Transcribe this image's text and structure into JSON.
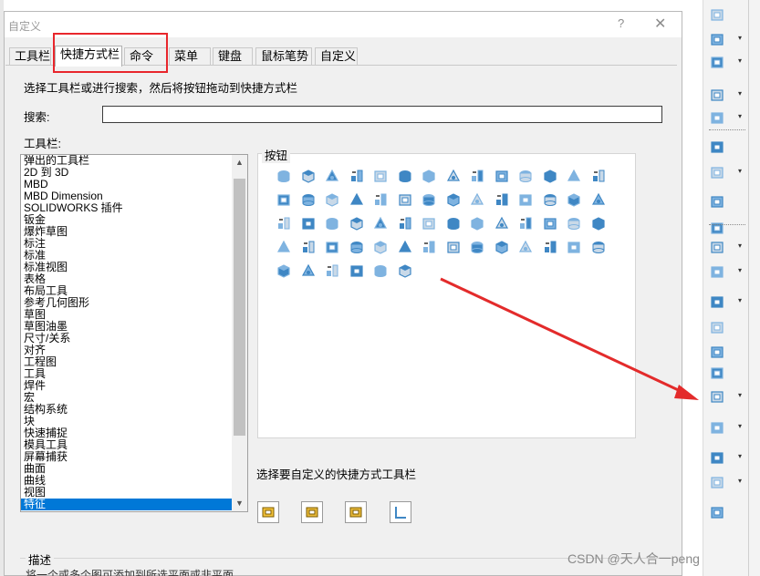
{
  "dialog": {
    "title": "自定义",
    "help_glyph": "?",
    "close_glyph": "✕"
  },
  "tabs": [
    {
      "label": "工具栏",
      "active": false
    },
    {
      "label": "快捷方式栏",
      "active": true
    },
    {
      "label": "命令",
      "active": false
    },
    {
      "label": "菜单",
      "active": false
    },
    {
      "label": "键盘",
      "active": false
    },
    {
      "label": "鼠标笔势",
      "active": false
    },
    {
      "label": "自定义",
      "active": false
    }
  ],
  "instruction": "选择工具栏或进行搜索，然后将按钮拖动到快捷方式栏",
  "search": {
    "label": "搜索:",
    "value": "",
    "placeholder": ""
  },
  "toolbars": {
    "label": "工具栏:",
    "items": [
      "弹出的工具栏",
      "2D 到 3D",
      "MBD",
      "MBD Dimension",
      "SOLIDWORKS 插件",
      "钣金",
      "爆炸草图",
      "标注",
      "标准",
      "标准视图",
      "表格",
      "布局工具",
      "参考几何图形",
      "草图",
      "草图油墨",
      "尺寸/关系",
      "对齐",
      "工程图",
      "工具",
      "焊件",
      "宏",
      "结构系统",
      "块",
      "快速捕捉",
      "模具工具",
      "屏幕捕获",
      "曲面",
      "曲线",
      "视图",
      "特征"
    ],
    "selected": "特征"
  },
  "buttons": {
    "title": "按钮",
    "icons": [
      "extruded-boss-icon",
      "revolved-boss-icon",
      "swept-boss-icon",
      "lofted-boss-icon",
      "boundary-boss-icon",
      "extruded-cut-icon",
      "hole-wizard-icon",
      "revolved-cut-icon",
      "swept-cut-icon",
      "lofted-cut-icon",
      "boundary-cut-icon",
      "cut-with-surface-icon",
      "thicken-icon",
      "solid-box-icon",
      "fillet-icon",
      "chamfer-icon",
      "rib-icon",
      "draft-icon",
      "shell-icon",
      "dome-icon",
      "wrap-icon",
      "intersect-icon",
      "cosmetic-thread-icon",
      "thread-icon",
      "combine-icon",
      "split-icon",
      "move-copy-icon",
      "delete-body-icon",
      "scale-icon",
      "flex-icon",
      "deform-icon",
      "indent-icon",
      "freeform-icon",
      "mirror-icon",
      "linear-pattern-icon",
      "circular-pattern-icon",
      "sketch-pattern-icon",
      "curve-pattern-icon",
      "table-pattern-icon",
      "fill-pattern-icon",
      "variable-pattern-icon",
      "reference-icon",
      "point-cloud-icon",
      "tool-table-icon",
      "library-icon",
      "part-icon",
      "face-body-icon",
      "save-bodies-icon",
      "insert-part-icon",
      "move-face-icon",
      "delete-face-icon",
      "sketch-driven-icon",
      "replace-face-icon",
      "mold-icon",
      "feature-works-icon",
      "explode-icon",
      "check-icon",
      "3d-grid-icon",
      "instant3d-icon",
      "simple-hole-icon",
      "boss-block-icon",
      "mirror-body-icon"
    ]
  },
  "shortcut_bar": {
    "label": "选择要自定义的快捷方式工具栏",
    "buttons": [
      "part-shortcut-icon",
      "assembly-shortcut-icon",
      "drawing-shortcut-icon",
      "sketch-shortcut-icon"
    ]
  },
  "description": {
    "title": "描述",
    "text": "将一个或多个图可添加到所选平面或非平面"
  },
  "right_toolbar": {
    "items": [
      {
        "icon": "smart-dimension-icon",
        "dropdown": false
      },
      {
        "icon": "pattern-icon",
        "dropdown": true
      },
      {
        "icon": "move-entities-icon",
        "dropdown": true
      },
      {
        "icon": "reference-plane-icon",
        "dropdown": true
      },
      {
        "icon": "display-style-icon",
        "dropdown": true
      },
      {
        "icon": "options-wrench-icon",
        "dropdown": false
      },
      {
        "icon": "view-orientation-icon",
        "dropdown": true
      },
      {
        "icon": "rebuild-icon",
        "dropdown": false
      },
      {
        "icon": "measure-icon",
        "dropdown": false
      },
      {
        "icon": "extruded-boss-icon",
        "dropdown": true
      },
      {
        "icon": "hole-wizard-icon",
        "dropdown": true
      },
      {
        "icon": "boundary-boss-icon",
        "dropdown": true
      },
      {
        "icon": "rib-icon",
        "dropdown": false
      },
      {
        "icon": "shell-icon",
        "dropdown": false
      },
      {
        "icon": "dome-icon",
        "dropdown": false
      },
      {
        "icon": "fillet-icon",
        "dropdown": true
      },
      {
        "icon": "linear-pattern-icon",
        "dropdown": true
      },
      {
        "icon": "reference-geometry-icon",
        "dropdown": true
      },
      {
        "icon": "curves-icon",
        "dropdown": true
      },
      {
        "icon": "instant3d-icon",
        "dropdown": false
      }
    ]
  },
  "watermark": "CSDN @天人合一peng",
  "colors": {
    "selection": "#0078d7",
    "highlight_box": "#e8262c",
    "arrow": "#e32b2b",
    "icon_blue": "#3f87c4",
    "icon_yellow": "#f3c23a"
  }
}
